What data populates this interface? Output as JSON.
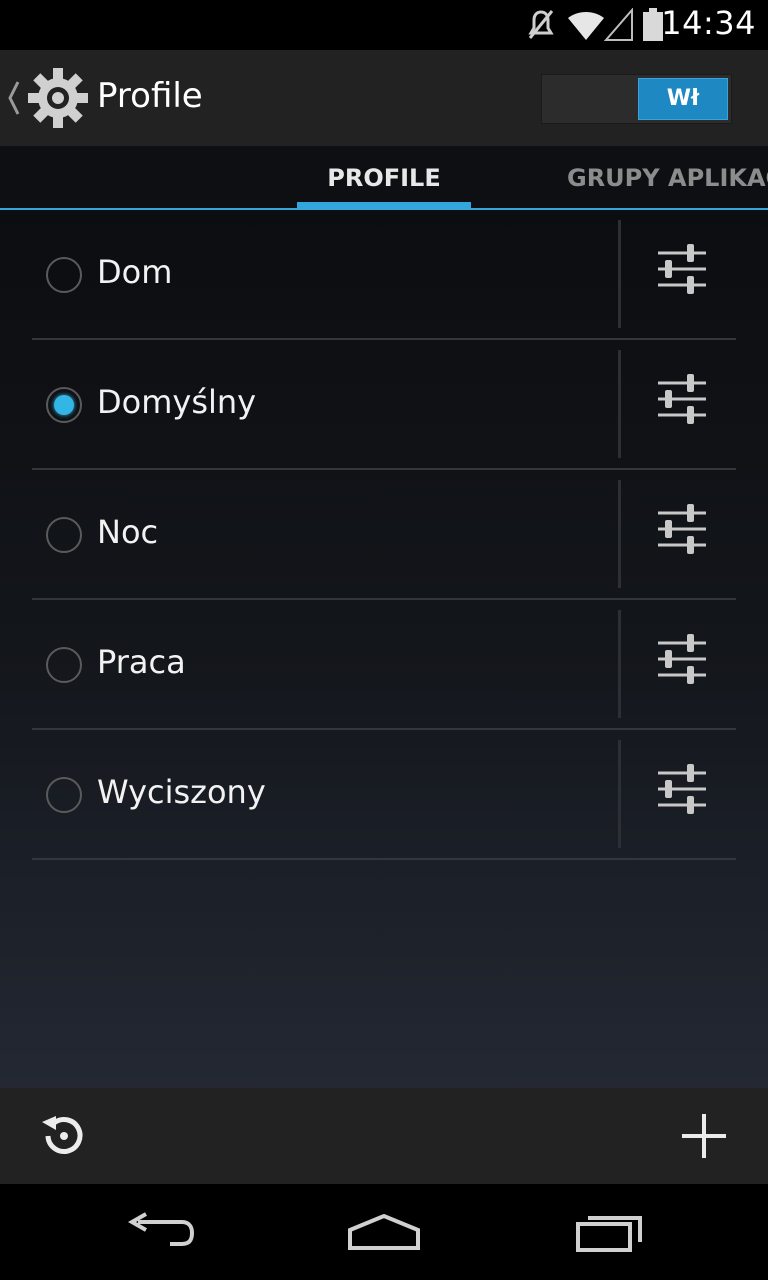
{
  "status_bar": {
    "time": "14:34",
    "icons": [
      "mute-icon",
      "wifi-icon",
      "signal-icon",
      "battery-icon"
    ]
  },
  "action_bar": {
    "title": "Profile",
    "icon": "gear-icon",
    "toggle_label": "Wł",
    "toggle_on": true
  },
  "tabs": [
    {
      "label": "PROFILE",
      "active": true
    },
    {
      "label": "GRUPY APLIKAC",
      "active": false
    }
  ],
  "profiles": [
    {
      "label": "Dom",
      "selected": false
    },
    {
      "label": "Domyślny",
      "selected": true
    },
    {
      "label": "Noc",
      "selected": false
    },
    {
      "label": "Praca",
      "selected": false
    },
    {
      "label": "Wyciszony",
      "selected": false
    }
  ],
  "bottom_bar": {
    "left_icon": "reset-icon",
    "right_icon": "add-icon"
  },
  "nav_bar": {
    "icons": [
      "back-icon",
      "home-icon",
      "recent-apps-icon"
    ]
  },
  "colors": {
    "accent": "#33b5e5",
    "toggle_on": "#1e88c3",
    "action_bar_bg": "#222222"
  }
}
